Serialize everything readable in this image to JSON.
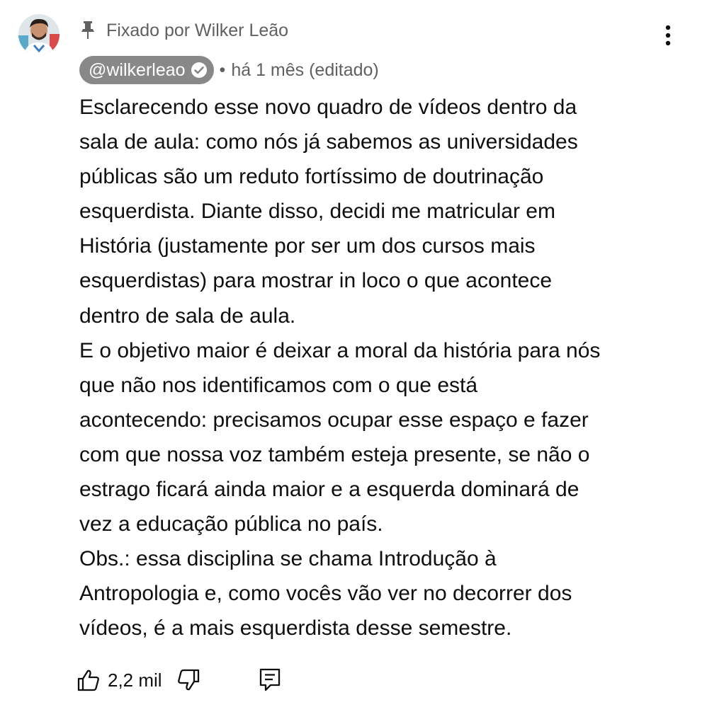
{
  "comment": {
    "pinned_text": "Fixado por Wilker Leão",
    "author": "@wilkerleao",
    "separator": "•",
    "timestamp": "há 1 mês (editado)",
    "lines": [
      "Esclarecendo esse novo quadro de vídeos dentro da",
      "sala de aula: como nós já sabemos as universidades",
      "públicas são um reduto fortíssimo de doutrinação",
      "esquerdista. Diante disso, decidi me matricular em",
      "História (justamente por ser um dos cursos mais",
      "esquerdistas) para mostrar in loco o que acontece",
      "dentro de sala de aula.",
      "E o objetivo maior é deixar a moral da história para nós",
      "que não nos identificamos com o que está",
      "acontecendo: precisamos ocupar esse espaço e fazer",
      "com que nossa voz também esteja presente, se não o",
      "estrago ficará ainda maior e a esquerda dominará de",
      "vez a educação pública no país.",
      "Obs.: essa disciplina se chama Introdução à",
      "Antropologia e, como vocês vão ver no decorrer dos",
      "vídeos, é a mais esquerdista desse semestre."
    ],
    "like_count": "2,2 mil"
  },
  "icons": {
    "pin": "pin-icon",
    "verified": "verified-check-icon",
    "menu": "more-vert-icon",
    "like": "thumbs-up-icon",
    "dislike": "thumbs-down-icon",
    "reply": "reply-comment-icon"
  },
  "colors": {
    "author_chip_bg": "#888888",
    "secondary_text": "#606060",
    "primary_text": "#0f0f0f"
  }
}
